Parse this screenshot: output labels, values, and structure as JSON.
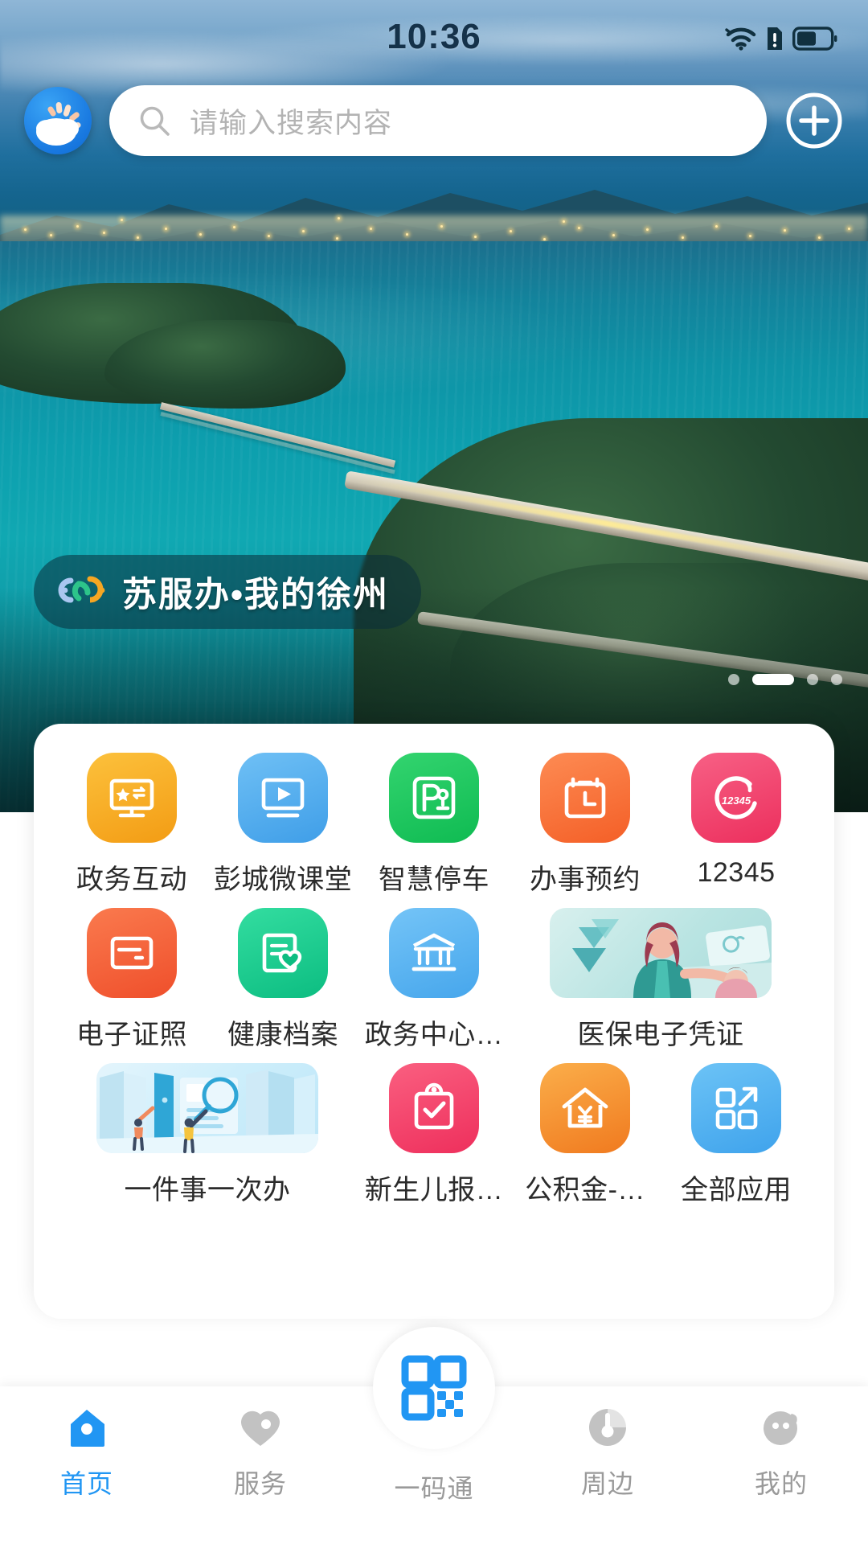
{
  "status_bar": {
    "time": "10:36",
    "icons": [
      "wifi-icon",
      "sim-alert-icon",
      "battery-icon"
    ],
    "battery_level_pct": 52
  },
  "header": {
    "app_logo_icon": "weather-cloud-sun-icon",
    "search": {
      "icon": "search-icon",
      "placeholder": "请输入搜索内容",
      "value": ""
    },
    "add_button": {
      "icon": "plus-circle-icon",
      "label": "添加"
    }
  },
  "hero": {
    "badge": {
      "logo_icon": "su-fu-ban-s-logo-icon",
      "text": "苏服办•我的徐州"
    },
    "pagination": {
      "total": 4,
      "active_index": 1
    }
  },
  "apps": {
    "rows": [
      [
        {
          "label": "政务互动",
          "icon": "monitor-star-exchange-icon",
          "color": "#f7a928",
          "wide": false
        },
        {
          "label": "彭城微课堂",
          "icon": "video-play-icon",
          "color": "#4fa8ec",
          "wide": false
        },
        {
          "label": "智慧停车",
          "icon": "parking-p-icon",
          "color": "#1fc860",
          "wide": false
        },
        {
          "label": "办事预约",
          "icon": "calendar-clock-icon",
          "color": "#f9713c",
          "wide": false
        },
        {
          "label": "12345",
          "icon": "hotline-12345-icon",
          "color": "#f0486e",
          "wide": false
        }
      ],
      [
        {
          "label": "电子证照",
          "icon": "id-card-icon",
          "color": "#f4633a",
          "wide": false
        },
        {
          "label": "健康档案",
          "icon": "document-heart-icon",
          "color": "#1fc98b",
          "wide": false
        },
        {
          "label": "政务中心…",
          "icon": "government-bank-icon",
          "color": "#59b4f2",
          "wide": false
        },
        {
          "label": "医保电子凭证",
          "icon": "medical-insurance-illustration",
          "color": "#b8e6e2",
          "wide": true
        }
      ],
      [
        {
          "label": "一件事一次办",
          "icon": "one-thing-one-time-illustration",
          "color": "#cfeaf8",
          "wide": true
        },
        {
          "label": "新生儿报…",
          "icon": "clipboard-check-icon",
          "color": "#f4476b",
          "wide": false
        },
        {
          "label": "公积金-…",
          "icon": "house-yuan-icon",
          "color": "#f89133",
          "wide": false
        },
        {
          "label": "全部应用",
          "icon": "grid-arrow-icon",
          "color": "#55b6f0",
          "wide": false
        }
      ]
    ]
  },
  "bottom_nav": {
    "items": [
      {
        "label": "首页",
        "icon": "home-icon",
        "active": true
      },
      {
        "label": "服务",
        "icon": "heart-icon",
        "active": false
      },
      {
        "label": "一码通",
        "icon": "qr-code-icon",
        "active": false
      },
      {
        "label": "周边",
        "icon": "compass-icon",
        "active": false
      },
      {
        "label": "我的",
        "icon": "profile-icon",
        "active": false
      }
    ],
    "active_color": "#2196f3",
    "inactive_color": "#9a9a9a"
  }
}
